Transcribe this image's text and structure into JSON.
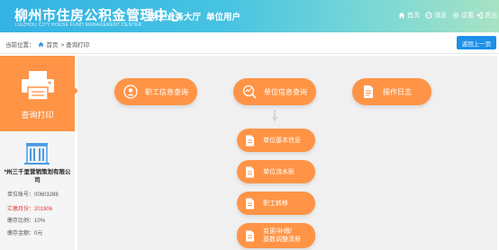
{
  "header": {
    "title": "柳州市住房公积金管理中心",
    "subtitle": "LIUZHOU CITY HOUSE FUND MANAGEMENT CENTER",
    "nav": [
      "网上业务大厅",
      "单位用户"
    ],
    "links": [
      {
        "label": "首页",
        "icon": "home-icon"
      },
      {
        "label": "消息",
        "icon": "message-icon"
      },
      {
        "label": "设置",
        "icon": "gear-icon"
      },
      {
        "label": "退出",
        "icon": "logout-icon"
      }
    ]
  },
  "breadcrumb": {
    "prefix": "当前位置：",
    "home": "首页",
    "current": "> 查询打印"
  },
  "back_button": "返回上一页",
  "sidebar": {
    "menu_label": "查询打印",
    "company_name": "*州三千里营销策划有限公司",
    "info": [
      {
        "label": "单位账号：",
        "value": "00603288",
        "highlight": false
      },
      {
        "label": "汇缴月份：",
        "value": "201906",
        "highlight": true
      },
      {
        "label": "缴存比例：",
        "value": "10%",
        "highlight": false
      },
      {
        "label": "缴存金额：",
        "value": "0元",
        "highlight": false
      }
    ]
  },
  "actions": {
    "top": [
      {
        "label": "职工信息查询",
        "icon": "person-search-icon"
      },
      {
        "label": "单位信息查询",
        "icon": "chart-search-icon"
      },
      {
        "label": "操作日志",
        "icon": "document-icon"
      }
    ],
    "sub": [
      {
        "label": "单位基本信息",
        "icon": "document-icon"
      },
      {
        "label": "单位流水账",
        "icon": "document-icon"
      },
      {
        "label": "职工转移",
        "icon": "document-icon"
      },
      {
        "label": "变更/补缴/基数调整清册",
        "line1": "变更/补缴/",
        "line2": "基数调整清册",
        "icon": "document-icon"
      }
    ]
  },
  "colors": {
    "accent": "#ff9446",
    "header_start": "#33b2e4",
    "button_blue": "#1d90e8",
    "highlight_red": "#ee3333"
  }
}
